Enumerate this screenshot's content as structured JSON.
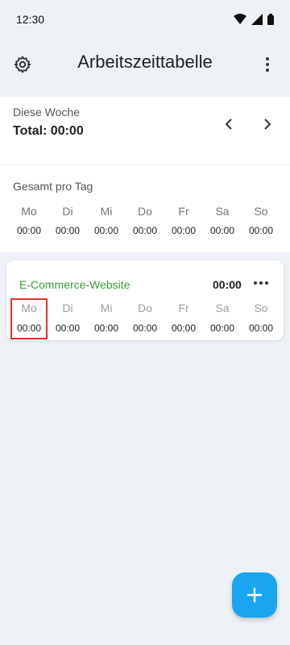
{
  "status": {
    "time": "12:30"
  },
  "app_bar": {
    "title": "Arbeitszeittabelle",
    "settings_icon": "gear-icon",
    "more_icon": "more-vert-icon"
  },
  "week": {
    "label": "Diese Woche",
    "total": "Total: 00:00"
  },
  "daily": {
    "title": "Gesamt pro Tag",
    "days": [
      "Mo",
      "Di",
      "Mi",
      "Do",
      "Fr",
      "Sa",
      "So"
    ],
    "times": [
      "00:00",
      "00:00",
      "00:00",
      "00:00",
      "00:00",
      "00:00",
      "00:00"
    ]
  },
  "project": {
    "name": "E-Commerce-Website",
    "total": "00:00",
    "days": [
      "Mo",
      "Di",
      "Mi",
      "Do",
      "Fr",
      "Sa",
      "So"
    ],
    "times": [
      "00:00",
      "00:00",
      "00:00",
      "00:00",
      "00:00",
      "00:00",
      "00:00"
    ],
    "name_color": "#3c9a3a"
  },
  "fab": {
    "icon": "plus-icon",
    "color": "#1aa5f0"
  }
}
